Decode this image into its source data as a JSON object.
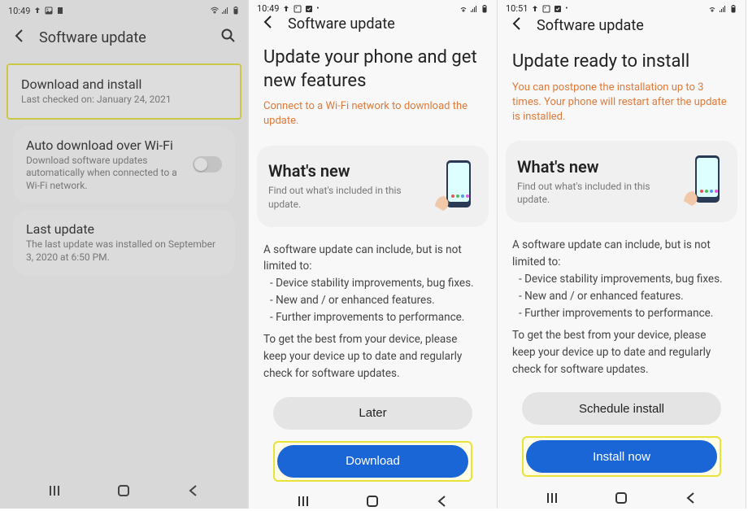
{
  "screen1": {
    "time": "10:49",
    "title": "Software update",
    "items": [
      {
        "title": "Download and install",
        "sub": "Last checked on: January 24, 2021"
      },
      {
        "title": "Auto download over Wi-Fi",
        "sub": "Download software updates automatically when connected to a Wi-Fi network."
      },
      {
        "title": "Last update",
        "sub": "The last update was installed on September 3, 2020 at 6:50 PM."
      }
    ]
  },
  "screen2": {
    "time": "10:49",
    "title": "Software update",
    "heading": "Update your phone and get new features",
    "sub_orange": "Connect to a Wi-Fi network to download the update.",
    "whatsnew": {
      "title": "What's new",
      "sub": "Find out what's included in this update."
    },
    "body_lead": "A software update can include, but is not limited to:",
    "bullets": [
      "- Device stability improvements, bug fixes.",
      "- New and / or enhanced features.",
      "- Further improvements to performance."
    ],
    "body_tail": "To get the best from your device, please keep your device up to date and regularly check for software updates.",
    "btn_secondary": "Later",
    "btn_primary": "Download"
  },
  "screen3": {
    "time": "10:51",
    "title": "Software update",
    "heading": "Update ready to install",
    "sub_orange": "You can postpone the installation up to 3 times. Your phone will restart after the update is installed.",
    "whatsnew": {
      "title": "What's new",
      "sub": "Find out what's included in this update."
    },
    "body_lead": "A software update can include, but is not limited to:",
    "bullets": [
      "- Device stability improvements, bug fixes.",
      "- New and / or enhanced features.",
      "- Further improvements to performance."
    ],
    "body_tail": "To get the best from your device, please keep your device up to date and regularly check for software updates.",
    "btn_secondary": "Schedule install",
    "btn_primary": "Install now"
  }
}
